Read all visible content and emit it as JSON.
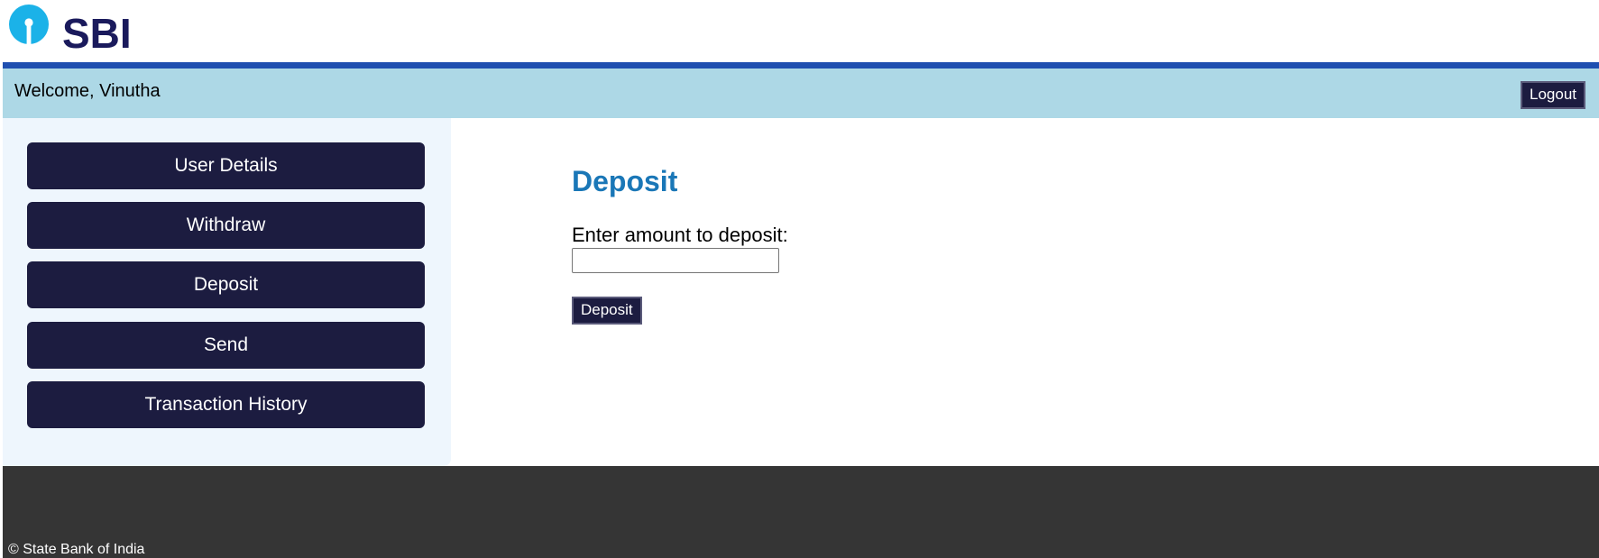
{
  "brand": {
    "name": "SBI",
    "colors": {
      "logo_circle": "#1bb2e8",
      "logo_text": "#1a1a5c",
      "header_rule": "#1f4fb0",
      "welcome_bar": "#add8e6",
      "button_bg": "#1c1c40",
      "heading": "#1a77b7",
      "footer_bg": "#353535"
    }
  },
  "header": {
    "welcome": "Welcome, Vinutha",
    "logout_label": "Logout"
  },
  "sidebar": {
    "items": [
      {
        "label": "User Details"
      },
      {
        "label": "Withdraw"
      },
      {
        "label": "Deposit"
      },
      {
        "label": "Send"
      },
      {
        "label": "Transaction History"
      }
    ]
  },
  "main": {
    "title": "Deposit",
    "amount_label": "Enter amount to deposit:",
    "amount_value": "",
    "amount_placeholder": "",
    "submit_label": "Deposit"
  },
  "footer": {
    "copyright": "© State Bank of India"
  }
}
